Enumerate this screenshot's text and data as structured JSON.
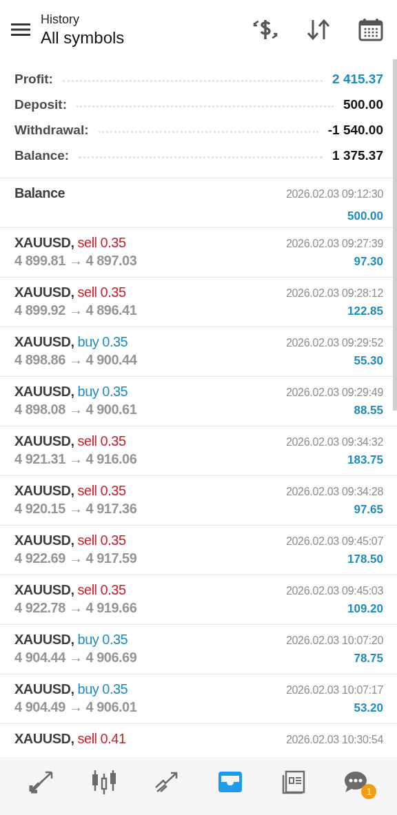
{
  "header": {
    "subtitle": "History",
    "title": "All symbols"
  },
  "summary": [
    {
      "label": "Profit:",
      "value": "2 415.37",
      "highlight": true
    },
    {
      "label": "Deposit:",
      "value": "500.00",
      "highlight": false
    },
    {
      "label": "Withdrawal:",
      "value": "-1 540.00",
      "highlight": false
    },
    {
      "label": "Balance:",
      "value": "1 375.37",
      "highlight": false
    }
  ],
  "deals": [
    {
      "kind": "balance",
      "title": "Balance",
      "time": "2026.02.03 09:12:30",
      "profit": "500.00"
    },
    {
      "kind": "trade",
      "symbol": "XAUUSD,",
      "side": "sell",
      "volume": "0.35",
      "prices": "4 899.81 → 4 897.03",
      "time": "2026.02.03 09:27:39",
      "profit": "97.30"
    },
    {
      "kind": "trade",
      "symbol": "XAUUSD,",
      "side": "sell",
      "volume": "0.35",
      "prices": "4 899.92 → 4 896.41",
      "time": "2026.02.03 09:28:12",
      "profit": "122.85"
    },
    {
      "kind": "trade",
      "symbol": "XAUUSD,",
      "side": "buy",
      "volume": "0.35",
      "prices": "4 898.86 → 4 900.44",
      "time": "2026.02.03 09:29:52",
      "profit": "55.30"
    },
    {
      "kind": "trade",
      "symbol": "XAUUSD,",
      "side": "buy",
      "volume": "0.35",
      "prices": "4 898.08 → 4 900.61",
      "time": "2026.02.03 09:29:49",
      "profit": "88.55"
    },
    {
      "kind": "trade",
      "symbol": "XAUUSD,",
      "side": "sell",
      "volume": "0.35",
      "prices": "4 921.31 → 4 916.06",
      "time": "2026.02.03 09:34:32",
      "profit": "183.75"
    },
    {
      "kind": "trade",
      "symbol": "XAUUSD,",
      "side": "sell",
      "volume": "0.35",
      "prices": "4 920.15 → 4 917.36",
      "time": "2026.02.03 09:34:28",
      "profit": "97.65"
    },
    {
      "kind": "trade",
      "symbol": "XAUUSD,",
      "side": "sell",
      "volume": "0.35",
      "prices": "4 922.69 → 4 917.59",
      "time": "2026.02.03 09:45:07",
      "profit": "178.50"
    },
    {
      "kind": "trade",
      "symbol": "XAUUSD,",
      "side": "sell",
      "volume": "0.35",
      "prices": "4 922.78 → 4 919.66",
      "time": "2026.02.03 09:45:03",
      "profit": "109.20"
    },
    {
      "kind": "trade",
      "symbol": "XAUUSD,",
      "side": "buy",
      "volume": "0.35",
      "prices": "4 904.44 → 4 906.69",
      "time": "2026.02.03 10:07:20",
      "profit": "78.75"
    },
    {
      "kind": "trade",
      "symbol": "XAUUSD,",
      "side": "buy",
      "volume": "0.35",
      "prices": "4 904.49 → 4 906.01",
      "time": "2026.02.03 10:07:17",
      "profit": "53.20"
    },
    {
      "kind": "trade",
      "symbol": "XAUUSD,",
      "side": "sell",
      "volume": "0.41",
      "time": "2026.02.03 10:30:54"
    }
  ],
  "nav": [
    {
      "kind": "quotes",
      "selected": false
    },
    {
      "kind": "chart",
      "selected": false
    },
    {
      "kind": "trade",
      "selected": false
    },
    {
      "kind": "history",
      "selected": true
    },
    {
      "kind": "news",
      "selected": false
    },
    {
      "kind": "messages",
      "selected": false,
      "badge": "1"
    }
  ]
}
